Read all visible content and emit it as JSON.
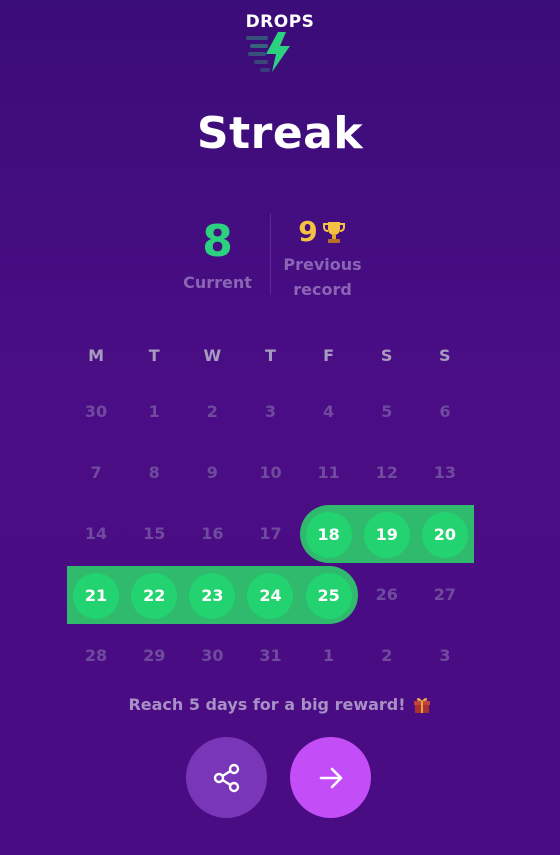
{
  "brand": {
    "name": "DROPS",
    "logo_icon": "lightning-bolt-icon",
    "accent": "#2bd17e"
  },
  "title": "Streak",
  "stats": {
    "current": {
      "value": "8",
      "label": "Current",
      "color": "#2bd17e"
    },
    "record": {
      "value": "9",
      "label_line1": "Previous",
      "label_line2": "record",
      "icon": "trophy-icon",
      "color": "#f5c142"
    }
  },
  "calendar": {
    "weekdays": [
      "M",
      "T",
      "W",
      "T",
      "F",
      "S",
      "S"
    ],
    "weeks": [
      [
        {
          "d": "30"
        },
        {
          "d": "1"
        },
        {
          "d": "2"
        },
        {
          "d": "3"
        },
        {
          "d": "4"
        },
        {
          "d": "5"
        },
        {
          "d": "6"
        }
      ],
      [
        {
          "d": "7"
        },
        {
          "d": "8"
        },
        {
          "d": "9"
        },
        {
          "d": "10"
        },
        {
          "d": "11"
        },
        {
          "d": "12"
        },
        {
          "d": "13"
        }
      ],
      [
        {
          "d": "14"
        },
        {
          "d": "15"
        },
        {
          "d": "16"
        },
        {
          "d": "17"
        },
        {
          "d": "18",
          "active": true
        },
        {
          "d": "19",
          "active": true
        },
        {
          "d": "20",
          "active": true
        }
      ],
      [
        {
          "d": "21",
          "active": true
        },
        {
          "d": "22",
          "active": true
        },
        {
          "d": "23",
          "active": true
        },
        {
          "d": "24",
          "active": true
        },
        {
          "d": "25",
          "active": true
        },
        {
          "d": "26"
        },
        {
          "d": "27"
        }
      ],
      [
        {
          "d": "28"
        },
        {
          "d": "29"
        },
        {
          "d": "30"
        },
        {
          "d": "31"
        },
        {
          "d": "1"
        },
        {
          "d": "2"
        },
        {
          "d": "3"
        }
      ]
    ],
    "streak_color": "#22d36f"
  },
  "reward": {
    "text": "Reach 5 days for a big reward!",
    "icon": "gift-icon"
  },
  "actions": {
    "share_icon": "share-icon",
    "next_icon": "arrow-right-icon"
  }
}
